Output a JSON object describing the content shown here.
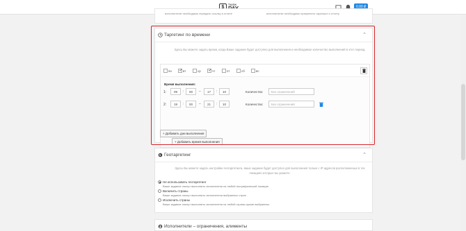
{
  "header": {
    "logo_top": "TASK",
    "logo_bottom": "PAY",
    "logo_mark": "$",
    "balance": "0.00 ₽"
  },
  "prev_card": {
    "left_text": "исполнителю необходимо передать ссылку в отчете",
    "right_text": "исполнителю необходимо прикрепить скриншот к отчету"
  },
  "time_targeting": {
    "title": "Таргетинг по времени",
    "description": "Здесь Вы можете задать время, когда Ваше задание будет доступно для выполнения и необходимое количество выполнений в этот период.",
    "days": [
      {
        "label": "пн",
        "checked": false
      },
      {
        "label": "вт",
        "checked": true
      },
      {
        "label": "ср",
        "checked": false
      },
      {
        "label": "чт",
        "checked": true
      },
      {
        "label": "пт",
        "checked": false
      },
      {
        "label": "сб",
        "checked": false
      },
      {
        "label": "вс",
        "checked": false
      }
    ],
    "time_label": "Время выполнения:",
    "rows": [
      {
        "num": "1:",
        "start_h": "09",
        "start_m": "00",
        "end_h": "17",
        "end_m": "10"
      },
      {
        "num": "2:",
        "start_h": "19",
        "start_m": "00",
        "end_h": "21",
        "end_m": "10"
      }
    ],
    "time_colon": ":",
    "range_dash": "–",
    "qty_label": "Количество:",
    "qty_placeholder": "Без ограничений",
    "add_time_label": "+ Добавить время выполнения",
    "add_days_label": "+ Добавить дни выполнения"
  },
  "geo_targeting": {
    "title": "Геотаргетинг",
    "description": "Здесь Вы можете задать настройки геотаргетинга, ваше задание будет доступно для выполнения только с IP адресов расположенных в тех локациях которые вы укажете.",
    "options": [
      {
        "label": "Не использовать геотаргетинг",
        "sub": "Ваше задание смогут выполнить исполнители из любой географической локации",
        "selected": true
      },
      {
        "label": "Включить страны",
        "sub": "Ваше задание смогут выполнить исполнители выбранных стран",
        "selected": false
      },
      {
        "label": "Исключить страны",
        "sub": "Ваше задание смогут выполнить исполнители из любой страны кроме выбранных",
        "selected": false
      }
    ]
  },
  "executor_section": {
    "title": "Исполнители – ограничения, алименты"
  },
  "icons": {
    "clock": "clock-icon",
    "globe": "globe-icon",
    "user": "user-icon",
    "trash": "trash-icon",
    "chat": "chat-icon",
    "bell": "bell-icon",
    "chevron": "chevron-up-icon"
  },
  "colors": {
    "accent": "#1e88e5",
    "highlight": "#d9232a"
  }
}
